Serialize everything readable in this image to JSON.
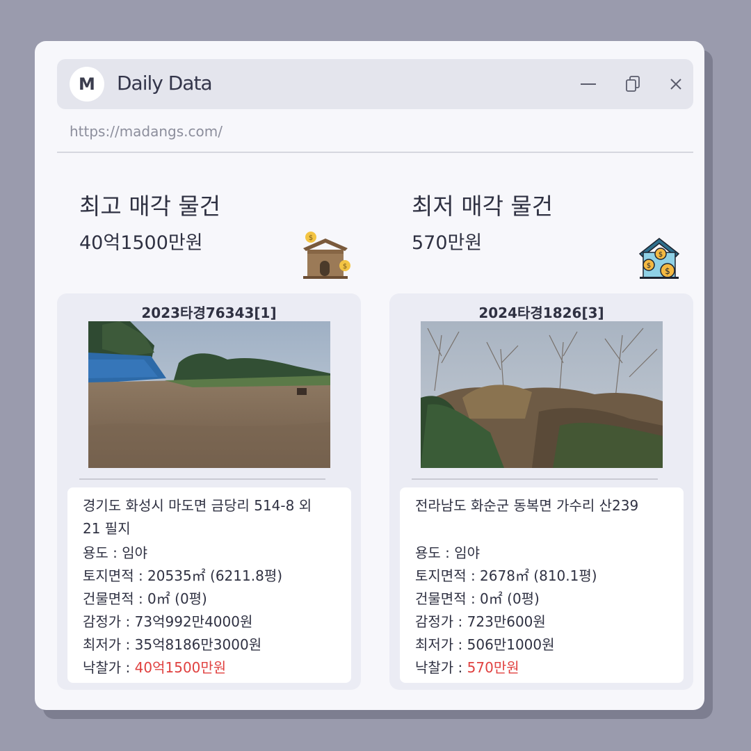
{
  "app": {
    "logo_letter": "M",
    "title": "Daily Data",
    "url": "https://madangs.com/"
  },
  "controls": {
    "minimize": "minimize-icon",
    "copy": "copy-icon",
    "close": "close-icon"
  },
  "highest": {
    "title": "최고 매각 물건",
    "value": "40억1500만원"
  },
  "lowest": {
    "title": "최저 매각 물건",
    "value": "570만원"
  },
  "cards": [
    {
      "case_id": "2023타경76343[1]",
      "address": "경기도 화성시 마도면 금당리 514-8 외 21 필지",
      "usage": "용도 : 임야",
      "land_area": "토지면적 : 20535㎡ (6211.8평)",
      "building_area": "건물면적 : 0㎡ (0평)",
      "appraisal": "감정가 : 73억992만4000원",
      "minimum": "최저가 : 35억8186만3000원",
      "winning_label": "낙찰가 : ",
      "winning_value": "40억1500만원"
    },
    {
      "case_id": "2024타경1826[3]",
      "address": "전라남도 화순군 동복면 가수리 산239",
      "usage": "용도 : 임야",
      "land_area": "토지면적 : 2678㎡ (810.1평)",
      "building_area": "건물면적 : 0㎡ (0평)",
      "appraisal": "감정가 : 723만600원",
      "minimum": "최저가 : 506만1000원",
      "winning_label": "낙찰가 : ",
      "winning_value": "570만원"
    }
  ],
  "colors": {
    "accent_price": "#e0403f",
    "background": "#9a9bad",
    "window": "#f7f7fb"
  }
}
